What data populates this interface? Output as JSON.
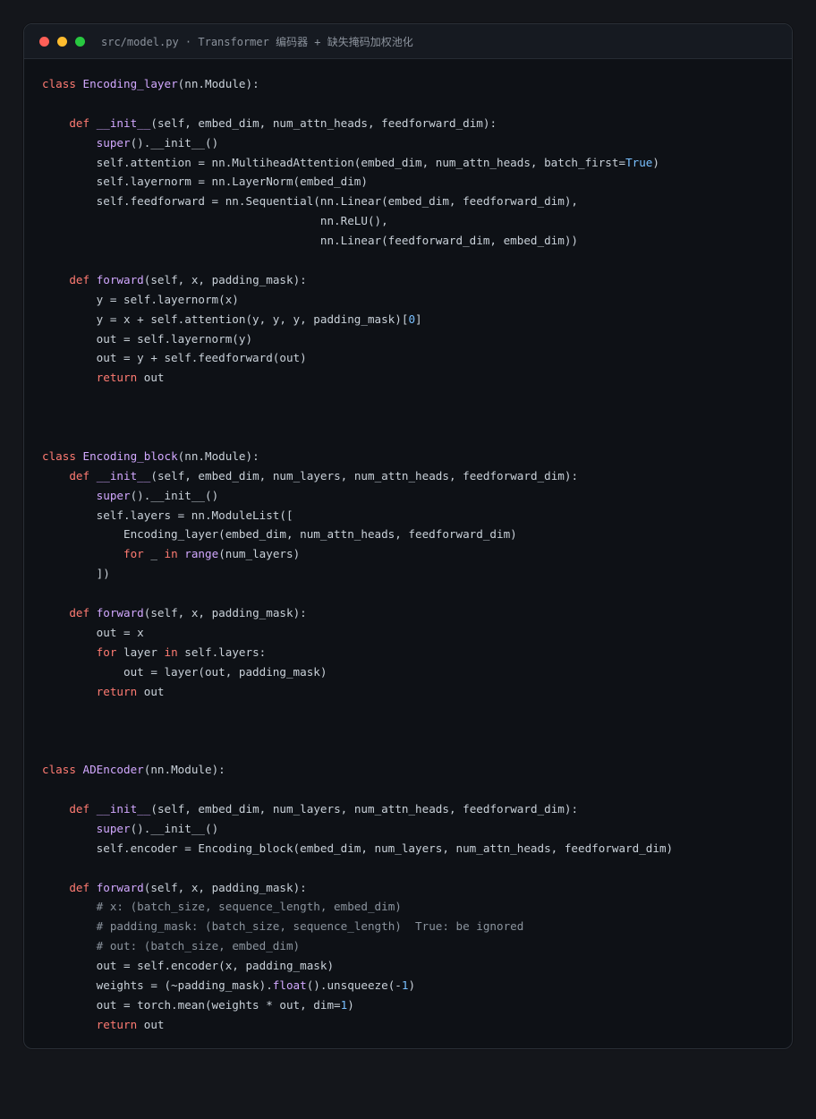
{
  "window": {
    "title": "src/model.py · Transformer 编码器 + 缺失掩码加权池化",
    "buttons": {
      "close_color": "#ff5f57",
      "minimize_color": "#febc2e",
      "zoom_color": "#28c840"
    }
  },
  "colors": {
    "keyword": "#ff7b72",
    "function": "#d2a8ff",
    "number": "#79c0ff",
    "comment": "#8b949e",
    "plain": "#c9d1d9",
    "background": "#0e1116"
  },
  "code_lines": [
    [
      [
        "kw",
        "class"
      ],
      [
        "pl",
        " "
      ],
      [
        "fn",
        "Encoding_layer"
      ],
      [
        "pl",
        "(nn.Module):"
      ]
    ],
    [],
    [
      [
        "pl",
        "    "
      ],
      [
        "kw",
        "def"
      ],
      [
        "pl",
        " "
      ],
      [
        "fn",
        "__init__"
      ],
      [
        "pl",
        "(self, embed_dim, num_attn_heads, feedforward_dim):"
      ]
    ],
    [
      [
        "pl",
        "        "
      ],
      [
        "fn",
        "super"
      ],
      [
        "pl",
        "().__init__()"
      ]
    ],
    [
      [
        "pl",
        "        self.attention = nn.MultiheadAttention(embed_dim, num_attn_heads, batch_first="
      ],
      [
        "num",
        "True"
      ],
      [
        "pl",
        ")"
      ]
    ],
    [
      [
        "pl",
        "        self.layernorm = nn.LayerNorm(embed_dim)"
      ]
    ],
    [
      [
        "pl",
        "        self.feedforward = nn.Sequential(nn.Linear(embed_dim, feedforward_dim),"
      ]
    ],
    [
      [
        "pl",
        "                                         nn.ReLU(),"
      ]
    ],
    [
      [
        "pl",
        "                                         nn.Linear(feedforward_dim, embed_dim))"
      ]
    ],
    [],
    [
      [
        "pl",
        "    "
      ],
      [
        "kw",
        "def"
      ],
      [
        "pl",
        " "
      ],
      [
        "fn",
        "forward"
      ],
      [
        "pl",
        "(self, x, padding_mask):"
      ]
    ],
    [
      [
        "pl",
        "        y = self.layernorm(x)"
      ]
    ],
    [
      [
        "pl",
        "        y = x + self.attention(y, y, y, padding_mask)["
      ],
      [
        "num",
        "0"
      ],
      [
        "pl",
        "]"
      ]
    ],
    [
      [
        "pl",
        "        out = self.layernorm(y)"
      ]
    ],
    [
      [
        "pl",
        "        out = y + self.feedforward(out)"
      ]
    ],
    [
      [
        "pl",
        "        "
      ],
      [
        "kw",
        "return"
      ],
      [
        "pl",
        " out"
      ]
    ],
    [],
    [],
    [],
    [
      [
        "kw",
        "class"
      ],
      [
        "pl",
        " "
      ],
      [
        "fn",
        "Encoding_block"
      ],
      [
        "pl",
        "(nn.Module):"
      ]
    ],
    [
      [
        "pl",
        "    "
      ],
      [
        "kw",
        "def"
      ],
      [
        "pl",
        " "
      ],
      [
        "fn",
        "__init__"
      ],
      [
        "pl",
        "(self, embed_dim, num_layers, num_attn_heads, feedforward_dim):"
      ]
    ],
    [
      [
        "pl",
        "        "
      ],
      [
        "fn",
        "super"
      ],
      [
        "pl",
        "().__init__()"
      ]
    ],
    [
      [
        "pl",
        "        self.layers = nn.ModuleList(["
      ]
    ],
    [
      [
        "pl",
        "            Encoding_layer(embed_dim, num_attn_heads, feedforward_dim)"
      ]
    ],
    [
      [
        "pl",
        "            "
      ],
      [
        "kw",
        "for"
      ],
      [
        "pl",
        " _ "
      ],
      [
        "kw",
        "in"
      ],
      [
        "pl",
        " "
      ],
      [
        "fn",
        "range"
      ],
      [
        "pl",
        "(num_layers)"
      ]
    ],
    [
      [
        "pl",
        "        ])"
      ]
    ],
    [],
    [
      [
        "pl",
        "    "
      ],
      [
        "kw",
        "def"
      ],
      [
        "pl",
        " "
      ],
      [
        "fn",
        "forward"
      ],
      [
        "pl",
        "(self, x, padding_mask):"
      ]
    ],
    [
      [
        "pl",
        "        out = x"
      ]
    ],
    [
      [
        "pl",
        "        "
      ],
      [
        "kw",
        "for"
      ],
      [
        "pl",
        " layer "
      ],
      [
        "kw",
        "in"
      ],
      [
        "pl",
        " self.layers:"
      ]
    ],
    [
      [
        "pl",
        "            out = layer(out, padding_mask)"
      ]
    ],
    [
      [
        "pl",
        "        "
      ],
      [
        "kw",
        "return"
      ],
      [
        "pl",
        " out"
      ]
    ],
    [],
    [],
    [],
    [
      [
        "kw",
        "class"
      ],
      [
        "pl",
        " "
      ],
      [
        "fn",
        "ADEncoder"
      ],
      [
        "pl",
        "(nn.Module):"
      ]
    ],
    [],
    [
      [
        "pl",
        "    "
      ],
      [
        "kw",
        "def"
      ],
      [
        "pl",
        " "
      ],
      [
        "fn",
        "__init__"
      ],
      [
        "pl",
        "(self, embed_dim, num_layers, num_attn_heads, feedforward_dim):"
      ]
    ],
    [
      [
        "pl",
        "        "
      ],
      [
        "fn",
        "super"
      ],
      [
        "pl",
        "().__init__()"
      ]
    ],
    [
      [
        "pl",
        "        self.encoder = Encoding_block(embed_dim, num_layers, num_attn_heads, feedforward_dim)"
      ]
    ],
    [],
    [
      [
        "pl",
        "    "
      ],
      [
        "kw",
        "def"
      ],
      [
        "pl",
        " "
      ],
      [
        "fn",
        "forward"
      ],
      [
        "pl",
        "(self, x, padding_mask):"
      ]
    ],
    [
      [
        "pl",
        "        "
      ],
      [
        "cm",
        "# x: (batch_size, sequence_length, embed_dim)"
      ]
    ],
    [
      [
        "pl",
        "        "
      ],
      [
        "cm",
        "# padding_mask: (batch_size, sequence_length)  True: be ignored"
      ]
    ],
    [
      [
        "pl",
        "        "
      ],
      [
        "cm",
        "# out: (batch_size, embed_dim)"
      ]
    ],
    [
      [
        "pl",
        "        out = self.encoder(x, padding_mask)"
      ]
    ],
    [
      [
        "pl",
        "        weights = (~padding_mask)."
      ],
      [
        "fn",
        "float"
      ],
      [
        "pl",
        "().unsqueeze(-"
      ],
      [
        "num",
        "1"
      ],
      [
        "pl",
        ")"
      ]
    ],
    [
      [
        "pl",
        "        out = torch.mean(weights * out, dim="
      ],
      [
        "num",
        "1"
      ],
      [
        "pl",
        ")"
      ]
    ],
    [
      [
        "pl",
        "        "
      ],
      [
        "kw",
        "return"
      ],
      [
        "pl",
        " out"
      ]
    ]
  ]
}
